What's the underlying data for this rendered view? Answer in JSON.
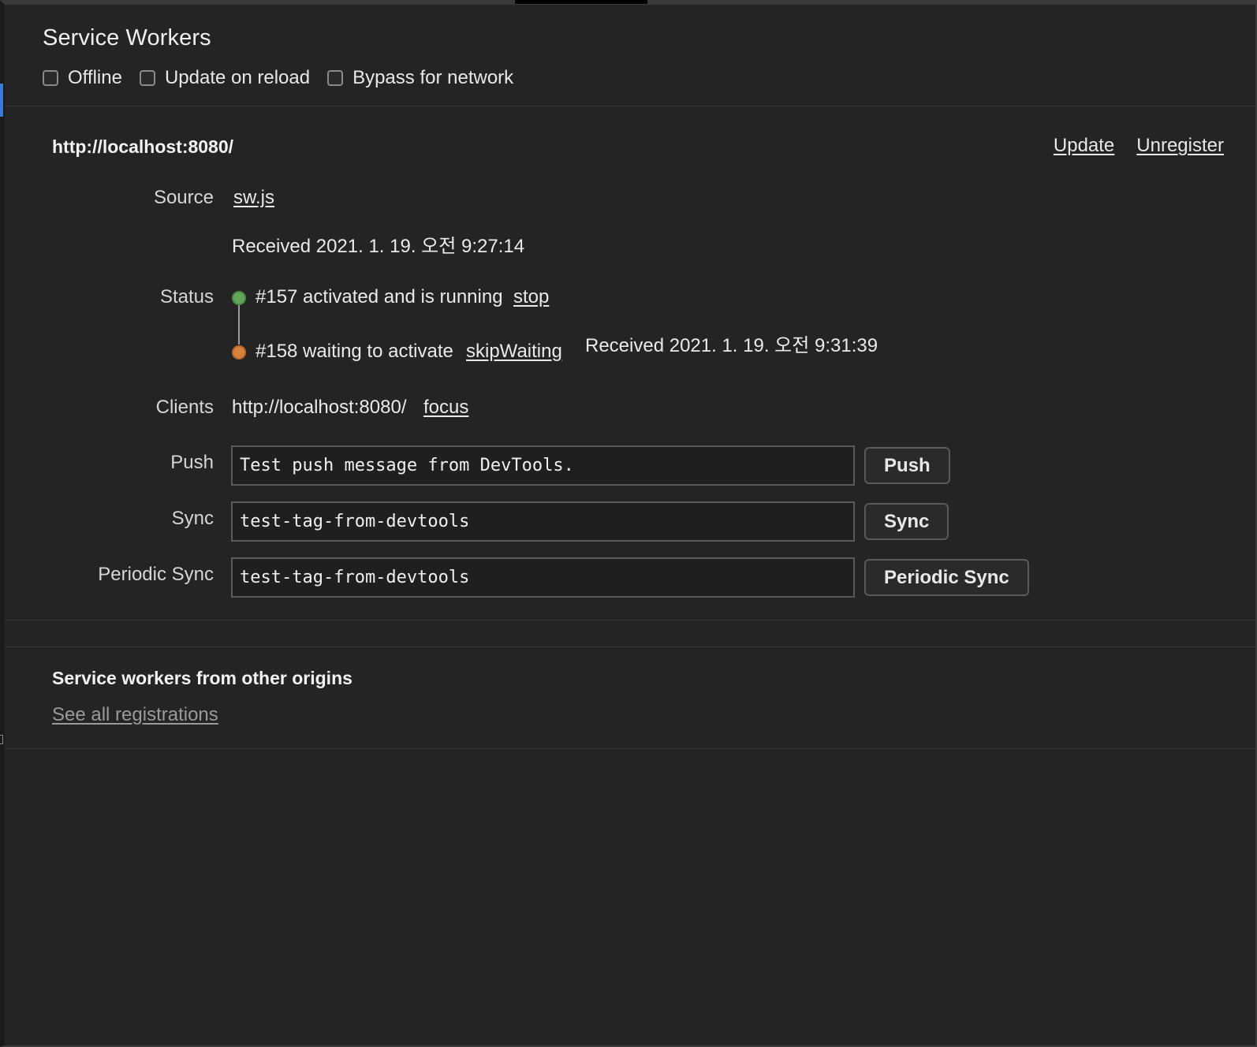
{
  "panel": {
    "title": "Service Workers",
    "options": [
      {
        "label": "Offline",
        "checked": false
      },
      {
        "label": "Update on reload",
        "checked": false
      },
      {
        "label": "Bypass for network",
        "checked": false
      }
    ]
  },
  "registration": {
    "origin": "http://localhost:8080/",
    "update_label": "Update",
    "unregister_label": "Unregister",
    "source_label": "Source",
    "source_file": "sw.js",
    "source_received": "Received 2021. 1. 19. 오전 9:27:14",
    "status_label": "Status",
    "statuses": [
      {
        "text": "#157 activated and is running",
        "action": "stop",
        "color": "#5fa85a"
      },
      {
        "text": "#158 waiting to activate",
        "action": "skipWaiting",
        "color": "#d9803a",
        "received": "Received 2021. 1. 19. 오전 9:31:39"
      }
    ],
    "clients_label": "Clients",
    "client_url": "http://localhost:8080/",
    "client_action": "focus",
    "push_label": "Push",
    "push_value": "Test push message from DevTools.",
    "push_button": "Push",
    "sync_label": "Sync",
    "sync_value": "test-tag-from-devtools",
    "sync_button": "Sync",
    "periodic_label": "Periodic Sync",
    "periodic_value": "test-tag-from-devtools",
    "periodic_button": "Periodic Sync"
  },
  "other_origins": {
    "title": "Service workers from other origins",
    "link": "See all registrations"
  },
  "colors": {
    "background": "#242424",
    "text": "#e8e8e8",
    "link_muted": "#9a9a9a",
    "running": "#5fa85a",
    "waiting": "#d9803a"
  }
}
